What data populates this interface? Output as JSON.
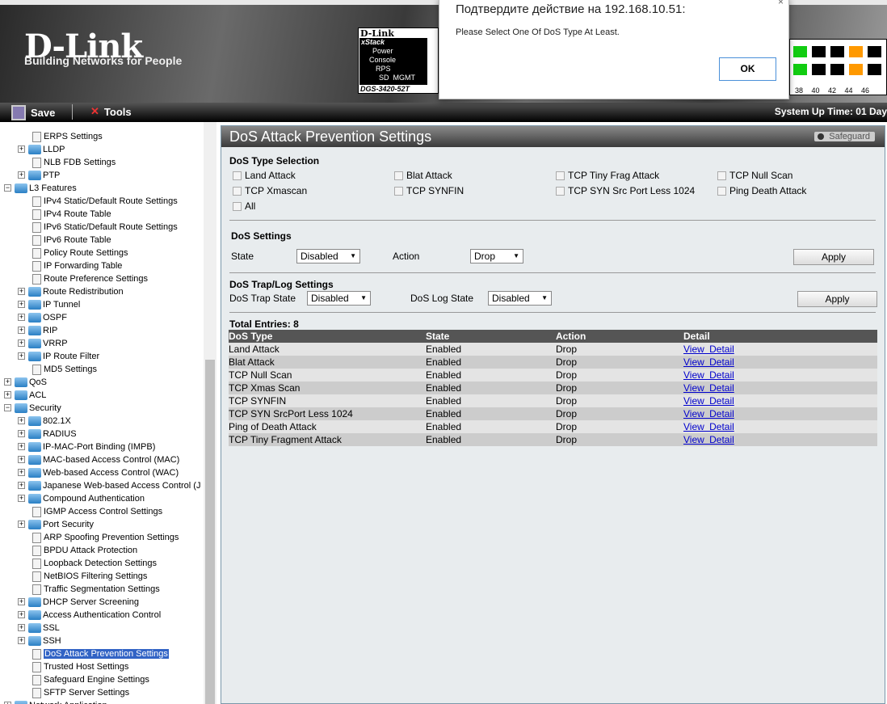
{
  "banner": {
    "logo": "D-Link",
    "tagline": "Building Networks for People",
    "device": {
      "brand": "D-Link",
      "series": "xStack",
      "leds": [
        "Power",
        "Console",
        "RPS",
        "SD  MGMT"
      ],
      "model": "DGS-3420-52T"
    },
    "port_numbers": "38 40 42 44 46"
  },
  "toolbar": {
    "save": "Save",
    "tools": "Tools",
    "uptime": "System Up Time: 01 Day"
  },
  "tree": [
    {
      "label": "ERPS Settings",
      "level": 1,
      "type": "doc"
    },
    {
      "label": "LLDP",
      "level": 1,
      "type": "folder",
      "exp": "+"
    },
    {
      "label": "NLB FDB Settings",
      "level": 1,
      "type": "doc"
    },
    {
      "label": "PTP",
      "level": 1,
      "type": "folder",
      "exp": "+"
    },
    {
      "label": "L3 Features",
      "level": 0,
      "type": "folder",
      "exp": "−"
    },
    {
      "label": "IPv4 Static/Default Route Settings",
      "level": 1,
      "type": "doc"
    },
    {
      "label": "IPv4 Route Table",
      "level": 1,
      "type": "doc"
    },
    {
      "label": "IPv6 Static/Default Route Settings",
      "level": 1,
      "type": "doc"
    },
    {
      "label": "IPv6 Route Table",
      "level": 1,
      "type": "doc"
    },
    {
      "label": "Policy Route Settings",
      "level": 1,
      "type": "doc"
    },
    {
      "label": "IP Forwarding Table",
      "level": 1,
      "type": "doc"
    },
    {
      "label": "Route Preference Settings",
      "level": 1,
      "type": "doc"
    },
    {
      "label": "Route Redistribution",
      "level": 1,
      "type": "folder",
      "exp": "+"
    },
    {
      "label": "IP Tunnel",
      "level": 1,
      "type": "folder",
      "exp": "+"
    },
    {
      "label": "OSPF",
      "level": 1,
      "type": "folder",
      "exp": "+"
    },
    {
      "label": "RIP",
      "level": 1,
      "type": "folder",
      "exp": "+"
    },
    {
      "label": "VRRP",
      "level": 1,
      "type": "folder",
      "exp": "+"
    },
    {
      "label": "IP Route Filter",
      "level": 1,
      "type": "folder",
      "exp": "+"
    },
    {
      "label": "MD5 Settings",
      "level": 1,
      "type": "doc"
    },
    {
      "label": "QoS",
      "level": 0,
      "type": "folder",
      "exp": "+"
    },
    {
      "label": "ACL",
      "level": 0,
      "type": "folder",
      "exp": "+"
    },
    {
      "label": "Security",
      "level": 0,
      "type": "folder",
      "exp": "−"
    },
    {
      "label": "802.1X",
      "level": 1,
      "type": "folder",
      "exp": "+"
    },
    {
      "label": "RADIUS",
      "level": 1,
      "type": "folder",
      "exp": "+"
    },
    {
      "label": "IP-MAC-Port Binding (IMPB)",
      "level": 1,
      "type": "folder",
      "exp": "+"
    },
    {
      "label": "MAC-based Access Control (MAC)",
      "level": 1,
      "type": "folder",
      "exp": "+"
    },
    {
      "label": "Web-based Access Control (WAC)",
      "level": 1,
      "type": "folder",
      "exp": "+"
    },
    {
      "label": "Japanese Web-based Access Control (J",
      "level": 1,
      "type": "folder",
      "exp": "+"
    },
    {
      "label": "Compound Authentication",
      "level": 1,
      "type": "folder",
      "exp": "+"
    },
    {
      "label": "IGMP Access Control Settings",
      "level": 1,
      "type": "doc"
    },
    {
      "label": "Port Security",
      "level": 1,
      "type": "folder",
      "exp": "+"
    },
    {
      "label": "ARP Spoofing Prevention Settings",
      "level": 1,
      "type": "doc"
    },
    {
      "label": "BPDU Attack Protection",
      "level": 1,
      "type": "doc"
    },
    {
      "label": "Loopback Detection Settings",
      "level": 1,
      "type": "doc"
    },
    {
      "label": "NetBIOS Filtering Settings",
      "level": 1,
      "type": "doc"
    },
    {
      "label": "Traffic Segmentation Settings",
      "level": 1,
      "type": "doc"
    },
    {
      "label": "DHCP Server Screening",
      "level": 1,
      "type": "folder",
      "exp": "+"
    },
    {
      "label": "Access Authentication Control",
      "level": 1,
      "type": "folder",
      "exp": "+"
    },
    {
      "label": "SSL",
      "level": 1,
      "type": "folder",
      "exp": "+"
    },
    {
      "label": "SSH",
      "level": 1,
      "type": "folder",
      "exp": "+"
    },
    {
      "label": "DoS Attack Prevention Settings",
      "level": 1,
      "type": "doc",
      "selected": true
    },
    {
      "label": "Trusted Host Settings",
      "level": 1,
      "type": "doc"
    },
    {
      "label": "Safeguard Engine Settings",
      "level": 1,
      "type": "doc"
    },
    {
      "label": "SFTP Server Settings",
      "level": 1,
      "type": "doc"
    },
    {
      "label": "Network Application",
      "level": 0,
      "type": "folder",
      "exp": "+"
    }
  ],
  "main": {
    "title": "DoS Attack Prevention Settings",
    "safeguard": "Safeguard",
    "type_selection": {
      "heading": "DoS Type Selection",
      "options": [
        "Land Attack",
        "Blat Attack",
        "TCP Tiny Frag Attack",
        "TCP Null Scan",
        "TCP Xmascan",
        "TCP SYNFIN",
        "TCP SYN Src Port Less 1024",
        "Ping Death Attack",
        "All"
      ]
    },
    "dos_settings": {
      "heading": "DoS Settings",
      "state_label": "State",
      "state_value": "Disabled",
      "action_label": "Action",
      "action_value": "Drop",
      "apply": "Apply"
    },
    "trap_log": {
      "heading": "DoS Trap/Log Settings",
      "trap_label": "DoS Trap State",
      "trap_value": "Disabled",
      "log_label": "DoS Log State",
      "log_value": "Disabled",
      "apply": "Apply"
    },
    "total": "Total Entries: 8",
    "table": {
      "headers": [
        "DoS Type",
        "State",
        "Action",
        "Detail"
      ],
      "rows": [
        [
          "Land Attack",
          "Enabled",
          "Drop",
          "View  Detail"
        ],
        [
          "Blat Attack",
          "Enabled",
          "Drop",
          "View  Detail"
        ],
        [
          "TCP Null Scan",
          "Enabled",
          "Drop",
          "View  Detail"
        ],
        [
          "TCP Xmas Scan",
          "Enabled",
          "Drop",
          "View  Detail"
        ],
        [
          "TCP SYNFIN",
          "Enabled",
          "Drop",
          "View  Detail"
        ],
        [
          "TCP SYN SrcPort Less 1024",
          "Enabled",
          "Drop",
          "View  Detail"
        ],
        [
          "Ping of Death Attack",
          "Enabled",
          "Drop",
          "View  Detail"
        ],
        [
          "TCP Tiny Fragment Attack",
          "Enabled",
          "Drop",
          "View  Detail"
        ]
      ]
    }
  },
  "dialog": {
    "title": "Подтвердите действие на 192.168.10.51:",
    "message": "Please Select One Of DoS Type At Least.",
    "ok": "OK",
    "close": "×"
  }
}
